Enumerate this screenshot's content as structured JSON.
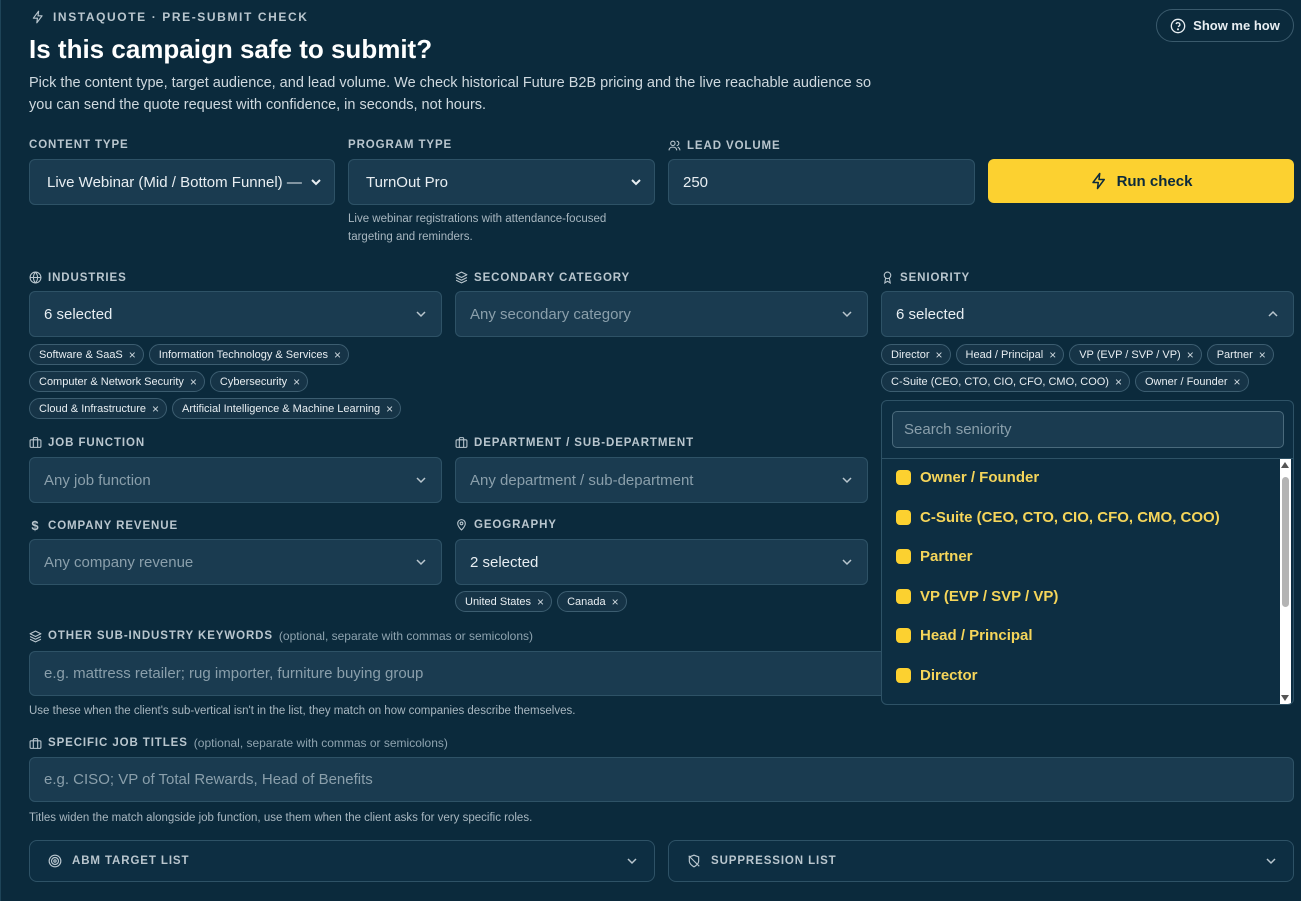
{
  "header": {
    "eyebrow": "INSTAQUOTE · PRE-SUBMIT CHECK",
    "title": "Is this campaign safe to submit?",
    "subtitle": "Pick the content type, target audience, and lead volume. We check historical Future B2B pricing and the live reachable audience so you can send the quote request with confidence, in seconds, not hours.",
    "show_me_how": "Show me how"
  },
  "row1": {
    "content_type": {
      "label": "CONTENT TYPE",
      "value": "Live Webinar (Mid / Bottom Funnel) —"
    },
    "program_type": {
      "label": "PROGRAM TYPE",
      "value": "TurnOut Pro",
      "help": "Live webinar registrations with attendance-focused targeting and reminders."
    },
    "lead_volume": {
      "label": "LEAD VOLUME",
      "value": "250"
    },
    "run_check": "Run check"
  },
  "industries": {
    "label": "INDUSTRIES",
    "value": "6 selected",
    "chips": [
      "Software & SaaS",
      "Information Technology & Services",
      "Computer & Network Security",
      "Cybersecurity",
      "Cloud & Infrastructure",
      "Artificial Intelligence & Machine Learning"
    ]
  },
  "secondary_category": {
    "label": "SECONDARY CATEGORY",
    "placeholder": "Any secondary category"
  },
  "seniority": {
    "label": "SENIORITY",
    "value": "6 selected",
    "chips": [
      "Director",
      "Head / Principal",
      "VP (EVP / SVP / VP)",
      "Partner",
      "C-Suite (CEO, CTO, CIO, CFO, CMO, COO)",
      "Owner / Founder"
    ],
    "search_placeholder": "Search seniority",
    "options": [
      "Owner / Founder",
      "C-Suite (CEO, CTO, CIO, CFO, CMO, COO)",
      "Partner",
      "VP (EVP / SVP / VP)",
      "Head / Principal",
      "Director"
    ]
  },
  "job_function": {
    "label": "JOB FUNCTION",
    "placeholder": "Any job function"
  },
  "department": {
    "label": "DEPARTMENT / SUB-DEPARTMENT",
    "placeholder": "Any department / sub-department"
  },
  "company_revenue": {
    "label": "COMPANY REVENUE",
    "placeholder": "Any company revenue"
  },
  "geography": {
    "label": "GEOGRAPHY",
    "value": "2 selected",
    "chips": [
      "United States",
      "Canada"
    ]
  },
  "sub_industry": {
    "label": "OTHER SUB-INDUSTRY KEYWORDS",
    "optional": "(optional, separate with commas or semicolons)",
    "placeholder": "e.g. mattress retailer; rug importer, furniture buying group",
    "help": "Use these when the client's sub-vertical isn't in the list, they match on how companies describe themselves."
  },
  "job_titles": {
    "label": "SPECIFIC JOB TITLES",
    "optional": "(optional, separate with commas or semicolons)",
    "placeholder": "e.g. CISO; VP of Total Rewards, Head of Benefits",
    "help": "Titles widen the match alongside job function, use them when the client asks for very specific roles."
  },
  "abm": {
    "label": "ABM TARGET LIST"
  },
  "suppression": {
    "label": "SUPPRESSION LIST"
  },
  "colors": {
    "accent": "#fcd130",
    "background": "#0b2a3c",
    "field": "#1a3b50"
  }
}
